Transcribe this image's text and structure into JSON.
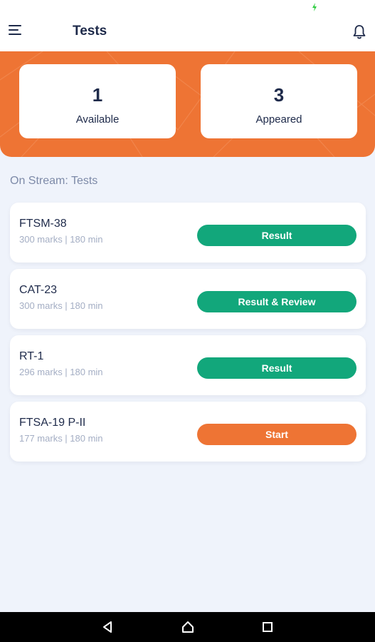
{
  "header": {
    "title": "Tests",
    "menu_icon": "menu-icon",
    "notification_icon": "bell-icon"
  },
  "stats": [
    {
      "value": "1",
      "label": "Available"
    },
    {
      "value": "3",
      "label": "Appeared"
    }
  ],
  "section": {
    "title": "On Stream: Tests"
  },
  "tests": [
    {
      "name": "FTSM-38",
      "meta": "300 marks | 180 min",
      "action": "Result",
      "status": "done"
    },
    {
      "name": "CAT-23",
      "meta": "300 marks | 180 min",
      "action": "Result & Review",
      "status": "done"
    },
    {
      "name": "RT-1",
      "meta": "296 marks | 180 min",
      "action": "Result",
      "status": "done"
    },
    {
      "name": "FTSA-19 P-II",
      "meta": "177 marks | 180 min",
      "action": "Start",
      "status": "pending"
    }
  ],
  "colors": {
    "accent": "#ee7434",
    "success": "#12a77b",
    "text": "#1e2a4a",
    "muted": "#a4aec4",
    "background": "#eff3fb"
  },
  "system_nav": {
    "back_icon": "back-triangle-icon",
    "home_icon": "home-icon",
    "recent_icon": "recent-apps-icon"
  }
}
